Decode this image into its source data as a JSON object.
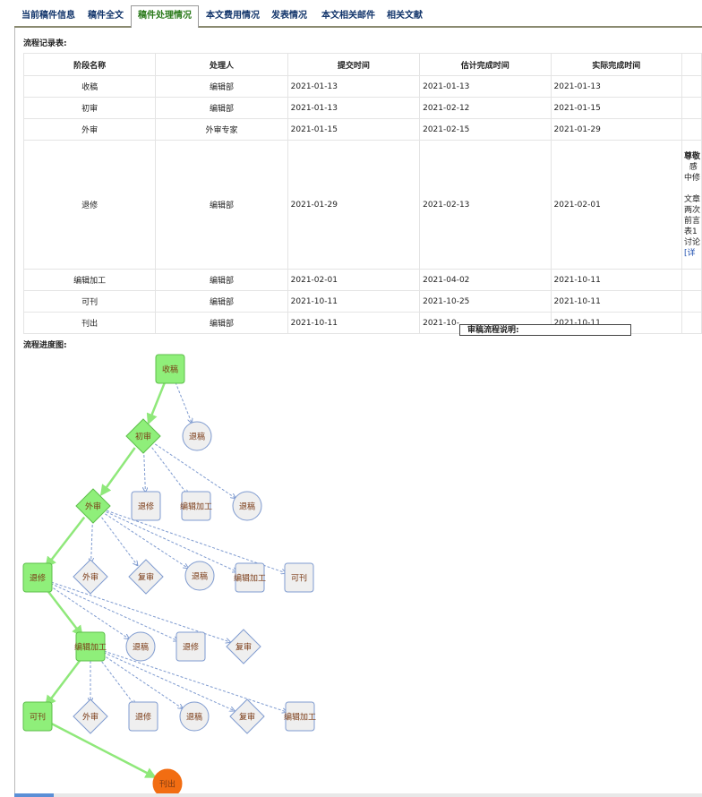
{
  "tabs": [
    {
      "label": "当前稿件信息"
    },
    {
      "label": "稿件全文"
    },
    {
      "label": "稿件处理情况"
    },
    {
      "label": "本文费用情况"
    },
    {
      "label": "发表情况"
    },
    {
      "label": "本文相关邮件"
    },
    {
      "label": "相关文献"
    }
  ],
  "active_tab": 2,
  "record_title": "流程记录表:",
  "progress_title": "流程进度图:",
  "table": {
    "headers": [
      "阶段名称",
      "处理人",
      "提交时间",
      "估计完成时间",
      "实际完成时间"
    ],
    "rows": [
      [
        "收稿",
        "编辑部",
        "2021-01-13",
        "2021-01-13",
        "2021-01-13"
      ],
      [
        "初审",
        "编辑部",
        "2021-01-13",
        "2021-02-12",
        "2021-01-15"
      ],
      [
        "外审",
        "外审专家",
        "2021-01-15",
        "2021-02-15",
        "2021-01-29"
      ],
      [
        "退修",
        "编辑部",
        "2021-01-29",
        "2021-02-13",
        "2021-02-01"
      ],
      [
        "编辑加工",
        "编辑部",
        "2021-02-01",
        "2021-04-02",
        "2021-10-11"
      ],
      [
        "可刊",
        "编辑部",
        "2021-10-11",
        "2021-10-25",
        "2021-10-11"
      ],
      [
        "刊出",
        "编辑部",
        "2021-10-11",
        "2021-10-",
        "2021-10-11"
      ]
    ],
    "note_lines": [
      "尊敬",
      "  感",
      "中修",
      "",
      "文章",
      "两次",
      "前言",
      "表1",
      "讨论"
    ],
    "note_link": "[详"
  },
  "tooltip": "审稿流程说明:",
  "flow": {
    "nodes": [
      {
        "label": "收稿",
        "shape": "rect",
        "state": "done"
      },
      {
        "label": "退稿",
        "shape": "circle",
        "state": "option"
      },
      {
        "label": "初审",
        "shape": "diamond",
        "state": "done"
      },
      {
        "label": "退修",
        "shape": "rect",
        "state": "option"
      },
      {
        "label": "编辑加工",
        "shape": "rect",
        "state": "option"
      },
      {
        "label": "退稿",
        "shape": "circle",
        "state": "option"
      },
      {
        "label": "外审",
        "shape": "diamond",
        "state": "done"
      },
      {
        "label": "退修",
        "shape": "rect",
        "state": "done"
      },
      {
        "label": "外审",
        "shape": "diamond",
        "state": "option"
      },
      {
        "label": "复审",
        "shape": "diamond",
        "state": "option"
      },
      {
        "label": "退稿",
        "shape": "circle",
        "state": "option"
      },
      {
        "label": "编辑加工",
        "shape": "rect",
        "state": "option"
      },
      {
        "label": "可刊",
        "shape": "rect",
        "state": "option"
      },
      {
        "label": "编辑加工",
        "shape": "rect",
        "state": "done"
      },
      {
        "label": "退稿",
        "shape": "circle",
        "state": "option"
      },
      {
        "label": "退修",
        "shape": "rect",
        "state": "option"
      },
      {
        "label": "复审",
        "shape": "diamond",
        "state": "option"
      },
      {
        "label": "可刊",
        "shape": "rect",
        "state": "done"
      },
      {
        "label": "外审",
        "shape": "diamond",
        "state": "option"
      },
      {
        "label": "退修",
        "shape": "rect",
        "state": "option"
      },
      {
        "label": "退稿",
        "shape": "circle",
        "state": "option"
      },
      {
        "label": "复审",
        "shape": "diamond",
        "state": "option"
      },
      {
        "label": "编辑加工",
        "shape": "rect",
        "state": "option"
      },
      {
        "label": "刊出",
        "shape": "circle",
        "state": "current"
      }
    ]
  },
  "colors": {
    "done_fill": "#8fef7a",
    "done_stroke": "#5cbf4a",
    "option_fill": "#efefef",
    "option_stroke": "#7f9bd0",
    "current_fill": "#f26d12",
    "path_color": "#8fe87a",
    "branch_color": "#7f9bd0",
    "node_text": "#7a3a14"
  }
}
